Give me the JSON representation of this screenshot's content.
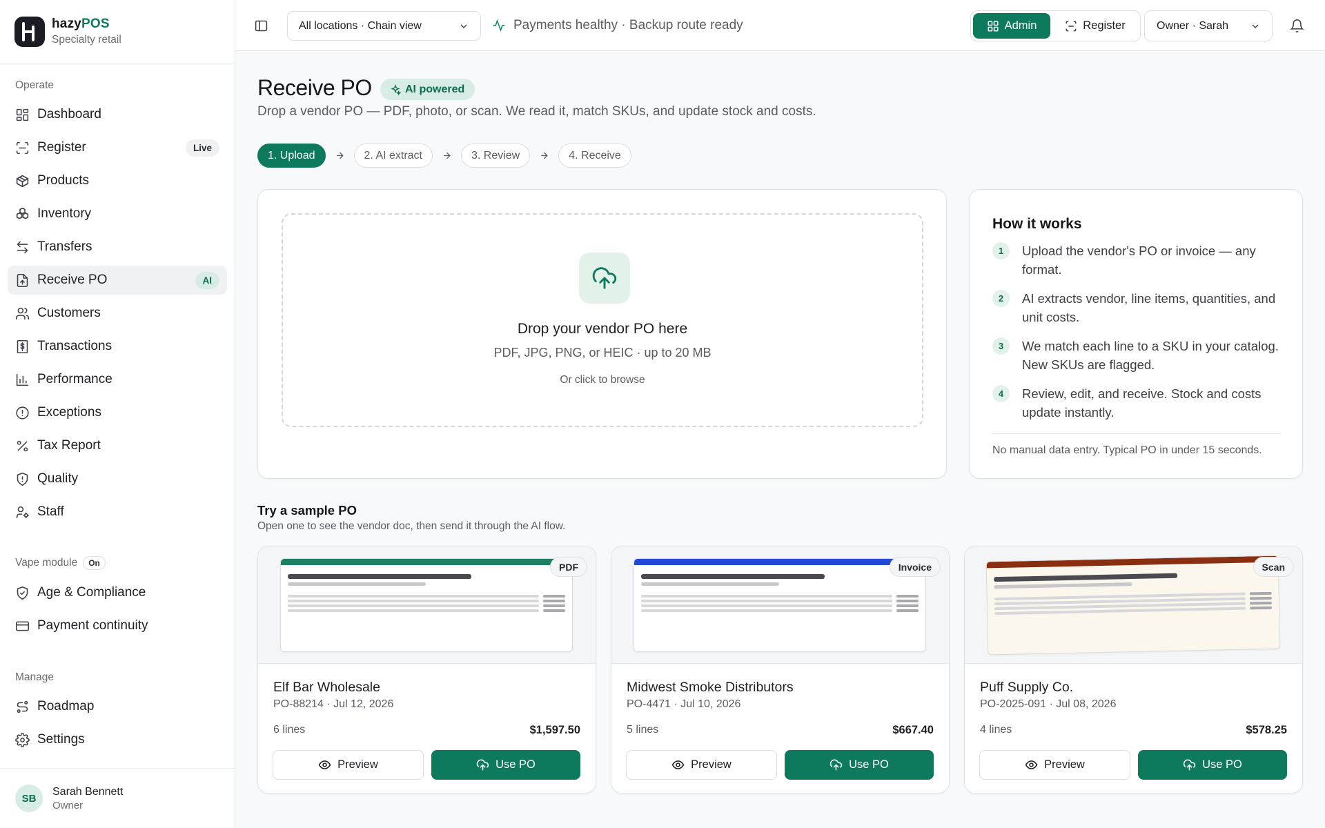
{
  "brand": {
    "name_prefix": "hazy",
    "name_suffix": "POS",
    "subtitle": "Specialty retail"
  },
  "sidebar": {
    "operate_label": "Operate",
    "operate_items": [
      {
        "label": "Dashboard",
        "icon": "dashboard-icon"
      },
      {
        "label": "Register",
        "icon": "scan-icon",
        "badge": "Live"
      },
      {
        "label": "Products",
        "icon": "box-icon"
      },
      {
        "label": "Inventory",
        "icon": "boxes-icon"
      },
      {
        "label": "Transfers",
        "icon": "arrows-icon"
      },
      {
        "label": "Receive PO",
        "icon": "file-icon",
        "badge": "AI",
        "active": true
      },
      {
        "label": "Customers",
        "icon": "users-icon"
      },
      {
        "label": "Transactions",
        "icon": "receipt-icon"
      },
      {
        "label": "Performance",
        "icon": "bar-chart-icon"
      },
      {
        "label": "Exceptions",
        "icon": "alert-circle-icon"
      },
      {
        "label": "Tax Report",
        "icon": "percent-icon"
      },
      {
        "label": "Quality",
        "icon": "shield-icon"
      },
      {
        "label": "Staff",
        "icon": "user-cog-icon"
      }
    ],
    "vape_label": "Vape module",
    "vape_badge": "On",
    "vape_items": [
      {
        "label": "Age & Compliance",
        "icon": "shield-check-icon"
      },
      {
        "label": "Payment continuity",
        "icon": "credit-card-icon"
      }
    ],
    "manage_label": "Manage",
    "manage_items": [
      {
        "label": "Roadmap",
        "icon": "roadmap-icon"
      },
      {
        "label": "Settings",
        "icon": "gear-icon"
      }
    ],
    "user": {
      "initials": "SB",
      "name": "Sarah Bennett",
      "role": "Owner"
    }
  },
  "topbar": {
    "location": "All locations · Chain view",
    "status": "Payments healthy · Backup route ready",
    "mode_admin": "Admin",
    "mode_register": "Register",
    "owner": "Owner · Sarah"
  },
  "page": {
    "title": "Receive PO",
    "badge": "AI powered",
    "subtitle": "Drop a vendor PO — PDF, photo, or scan. We read it, match SKUs, and update stock and costs.",
    "steps": [
      "1. Upload",
      "2. AI extract",
      "3. Review",
      "4. Receive"
    ],
    "active_step": 0
  },
  "dropzone": {
    "title": "Drop your vendor PO here",
    "formats": "PDF, JPG, PNG, or HEIC · up to 20 MB",
    "browse": "Or click to browse"
  },
  "how": {
    "title": "How it works",
    "items": [
      {
        "num": "1",
        "text": "Upload the vendor's PO or invoice — any format."
      },
      {
        "num": "2",
        "text": "AI extracts vendor, line items, quantities, and unit costs."
      },
      {
        "num": "3",
        "text": "We match each line to a SKU in your catalog. New SKUs are flagged."
      },
      {
        "num": "4",
        "text": "Review, edit, and receive. Stock and costs update instantly."
      }
    ],
    "footer": "No manual data entry. Typical PO in under 15 seconds."
  },
  "samples": {
    "title": "Try a sample PO",
    "subtitle": "Open one to see the vendor doc, then send it through the AI flow.",
    "preview_label": "Preview",
    "use_label": "Use PO",
    "items": [
      {
        "vendor": "Elf Bar Wholesale",
        "meta": "PO-88214 · Jul 12, 2026",
        "lines": "6 lines",
        "total": "$1,597.50",
        "tag": "PDF",
        "accent": "#1a7f63"
      },
      {
        "vendor": "Midwest Smoke Distributors",
        "meta": "PO-4471 · Jul 10, 2026",
        "lines": "5 lines",
        "total": "$667.40",
        "tag": "Invoice",
        "accent": "#2448d6"
      },
      {
        "vendor": "Puff Supply Co.",
        "meta": "PO-2025-091 · Jul 08, 2026",
        "lines": "4 lines",
        "total": "$578.25",
        "tag": "Scan",
        "accent": "#8a2e12"
      }
    ]
  },
  "colors": {
    "brand": "#0e7a5d",
    "brand_soft": "#d7ece4"
  }
}
